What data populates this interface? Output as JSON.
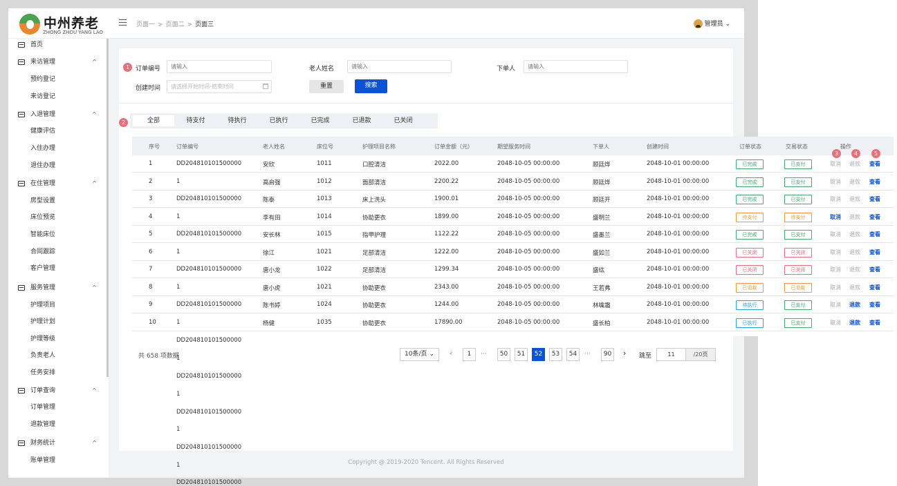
{
  "brand": {
    "name": "中州养老",
    "sub": "ZHONG ZHOU YANG LAO"
  },
  "breadcrumb": [
    "页面一",
    "页面二",
    "页面三"
  ],
  "breadcrumb_sep": ">",
  "user": {
    "name": "管理员",
    "arrow": "⌄"
  },
  "menu": [
    {
      "kind": "top",
      "label": "首页",
      "arrow": ""
    },
    {
      "kind": "top",
      "label": "来访管理",
      "arrow": "^"
    },
    {
      "kind": "sub",
      "label": "预约登记"
    },
    {
      "kind": "sub",
      "label": "来访登记"
    },
    {
      "kind": "top",
      "label": "入退管理",
      "arrow": "^"
    },
    {
      "kind": "sub",
      "label": "健康评估"
    },
    {
      "kind": "sub",
      "label": "入住办理"
    },
    {
      "kind": "sub",
      "label": "退住办理"
    },
    {
      "kind": "top",
      "label": "在住管理",
      "arrow": "^"
    },
    {
      "kind": "sub",
      "label": "房型设置"
    },
    {
      "kind": "sub",
      "label": "床位预览"
    },
    {
      "kind": "sub",
      "label": "智能床位"
    },
    {
      "kind": "sub",
      "label": "合同跟踪"
    },
    {
      "kind": "sub",
      "label": "客户管理"
    },
    {
      "kind": "top",
      "label": "服务管理",
      "arrow": "^"
    },
    {
      "kind": "sub",
      "label": "护理项目"
    },
    {
      "kind": "sub",
      "label": "护理计划"
    },
    {
      "kind": "sub",
      "label": "护理等级"
    },
    {
      "kind": "sub",
      "label": "负责老人"
    },
    {
      "kind": "sub",
      "label": "任务安排"
    },
    {
      "kind": "top",
      "label": "订单查询",
      "arrow": "^"
    },
    {
      "kind": "sub",
      "label": "订单管理"
    },
    {
      "kind": "sub",
      "label": "退款管理"
    },
    {
      "kind": "top",
      "label": "财务统计",
      "arrow": "^"
    },
    {
      "kind": "sub",
      "label": "账单管理"
    }
  ],
  "filters": {
    "order_no": {
      "label": "订单编号",
      "placeholder": "请输入"
    },
    "elder_name": {
      "label": "老人姓名",
      "placeholder": "请输入"
    },
    "orderer": {
      "label": "下单人",
      "placeholder": "请输入"
    },
    "created": {
      "label": "创建时间",
      "placeholder": "请选择开始时间-结束时间"
    },
    "reset": "重置",
    "search": "搜索"
  },
  "badges": [
    "1",
    "2",
    "3",
    "4",
    "5"
  ],
  "tabs": [
    "全部",
    "待支付",
    "待执行",
    "已执行",
    "已完成",
    "已退款",
    "已关闭"
  ],
  "colors": {
    "primary": "#0a52d8",
    "green": "#3fae6e",
    "orange": "#f09a3e",
    "red": "#e8707a",
    "blue": "#2aa3d8",
    "grey": "#aaaaaa"
  },
  "table": {
    "headers": [
      "序号",
      "订单编号",
      "老人姓名",
      "床位号",
      "护理项目名称",
      "订单金额（元）",
      "期望服务时间",
      "下单人",
      "创建时间",
      "订单状态",
      "交易状态",
      "操作"
    ],
    "rows": [
      {
        "no": "1",
        "order": "DD204810101500000",
        "name": "安欣",
        "bed": "1011",
        "item": "口腔清洁",
        "amount": "2022.00",
        "expect": "2048-10-05 00:00:00",
        "by": "顾廷烨",
        "created": "2048-10-01 00:00:00",
        "status": "已完成",
        "sc": "green",
        "trade": "已支付",
        "tc": "green",
        "ops": [
          {
            "t": "取消",
            "a": false
          },
          {
            "t": "退款",
            "a": false
          },
          {
            "t": "查看",
            "a": true
          }
        ]
      },
      {
        "no": "2",
        "order": "1",
        "name": "高启强",
        "bed": "1012",
        "item": "面部清洁",
        "amount": "2200.22",
        "expect": "2048-10-05 00:00:00",
        "by": "顾廷烨",
        "created": "2048-10-01 00:00:00",
        "status": "已完成",
        "sc": "green",
        "trade": "已支付",
        "tc": "green",
        "ops": [
          {
            "t": "取消",
            "a": false
          },
          {
            "t": "退款",
            "a": false
          },
          {
            "t": "查看",
            "a": true
          }
        ]
      },
      {
        "no": "3",
        "order": "DD204810101500000",
        "name": "陈泰",
        "bed": "1013",
        "item": "床上洗头",
        "amount": "1900.01",
        "expect": "2048-10-05 00:00:00",
        "by": "顾廷开",
        "created": "2048-10-01 00:00:00",
        "status": "已完成",
        "sc": "green",
        "trade": "已支付",
        "tc": "green",
        "ops": [
          {
            "t": "取消",
            "a": false
          },
          {
            "t": "退款",
            "a": false
          },
          {
            "t": "查看",
            "a": true
          }
        ]
      },
      {
        "no": "4",
        "order": "1",
        "name": "李有田",
        "bed": "1014",
        "item": "协助更衣",
        "amount": "1899.00",
        "expect": "2048-10-05 00:00:00",
        "by": "盛明兰",
        "created": "2048-10-01 00:00:00",
        "status": "待支付",
        "sc": "orange",
        "trade": "待支付",
        "tc": "orange",
        "ops": [
          {
            "t": "取消",
            "a": true
          },
          {
            "t": "退款",
            "a": false
          },
          {
            "t": "查看",
            "a": true
          }
        ]
      },
      {
        "no": "5",
        "order": "DD204810101500000",
        "name": "安长林",
        "bed": "1015",
        "item": "指甲护理",
        "amount": "1122.22",
        "expect": "2048-10-05 00:00:00",
        "by": "盛墨兰",
        "created": "2048-10-01 00:00:00",
        "status": "已完成",
        "sc": "green",
        "trade": "已支付",
        "tc": "green",
        "ops": [
          {
            "t": "取消",
            "a": false
          },
          {
            "t": "退款",
            "a": false
          },
          {
            "t": "查看",
            "a": true
          }
        ]
      },
      {
        "no": "6",
        "order": "1",
        "name": "徐江",
        "bed": "1021",
        "item": "足部清洁",
        "amount": "1222.00",
        "expect": "2048-10-05 00:00:00",
        "by": "盛如兰",
        "created": "2048-10-01 00:00:00",
        "status": "已关闭",
        "sc": "red",
        "trade": "已关闭",
        "tc": "red",
        "ops": [
          {
            "t": "取消",
            "a": false
          },
          {
            "t": "退款",
            "a": false
          },
          {
            "t": "查看",
            "a": true
          }
        ]
      },
      {
        "no": "7",
        "order": "DD204810101500000",
        "name": "唐小龙",
        "bed": "1022",
        "item": "足部清洁",
        "amount": "1299.34",
        "expect": "2048-10-05 00:00:00",
        "by": "盛纮",
        "created": "2048-10-01 00:00:00",
        "status": "已关闭",
        "sc": "red",
        "trade": "已关闭",
        "tc": "red",
        "ops": [
          {
            "t": "取消",
            "a": false
          },
          {
            "t": "退款",
            "a": false
          },
          {
            "t": "查看",
            "a": true
          }
        ]
      },
      {
        "no": "8",
        "order": "1",
        "name": "唐小虎",
        "bed": "1021",
        "item": "协助更衣",
        "amount": "2343.00",
        "expect": "2048-10-05 00:00:00",
        "by": "王若弗",
        "created": "2048-10-01 00:00:00",
        "status": "已退款",
        "sc": "orange",
        "trade": "已退款",
        "tc": "orange",
        "ops": [
          {
            "t": "取消",
            "a": false
          },
          {
            "t": "退款",
            "a": false
          },
          {
            "t": "查看",
            "a": true
          }
        ]
      },
      {
        "no": "9",
        "order": "DD204810101500000",
        "name": "陈书婷",
        "bed": "1024",
        "item": "协助更衣",
        "amount": "1244.00",
        "expect": "2048-10-05 00:00:00",
        "by": "林噙霜",
        "created": "2048-10-01 00:00:00",
        "status": "待执行",
        "sc": "blue",
        "trade": "已支付",
        "tc": "green",
        "ops": [
          {
            "t": "取消",
            "a": false
          },
          {
            "t": "退款",
            "a": true
          },
          {
            "t": "查看",
            "a": true
          }
        ]
      },
      {
        "no": "10",
        "order": "1",
        "name": "杨健",
        "bed": "1035",
        "item": "协助更衣",
        "amount": "17890.00",
        "expect": "2048-10-05 00:00:00",
        "by": "盛长柏",
        "created": "2048-10-01 00:00:00",
        "status": "已执行",
        "sc": "blue",
        "trade": "已支付",
        "tc": "green",
        "ops": [
          {
            "t": "取消",
            "a": false
          },
          {
            "t": "退款",
            "a": true
          },
          {
            "t": "查看",
            "a": true
          }
        ]
      }
    ],
    "overflow": [
      "DD204810101500000",
      "1",
      "DD204810101500000",
      "1",
      "DD204810101500000",
      "1",
      "DD204810101500000",
      "1",
      "DD204810101500000"
    ]
  },
  "pagination": {
    "total": "共 658 项数据",
    "size": "10条/页 ⌄",
    "prev": "‹",
    "next": "›",
    "dots": "···",
    "pages": [
      "1",
      "50",
      "51",
      "52",
      "53",
      "54",
      "90"
    ],
    "current": "52",
    "jump_label": "跳至",
    "jump_value": "11",
    "jump_suffix": "/20页"
  },
  "footer": "Copyright @ 2019-2020 Tencent. All Rights Reserved"
}
